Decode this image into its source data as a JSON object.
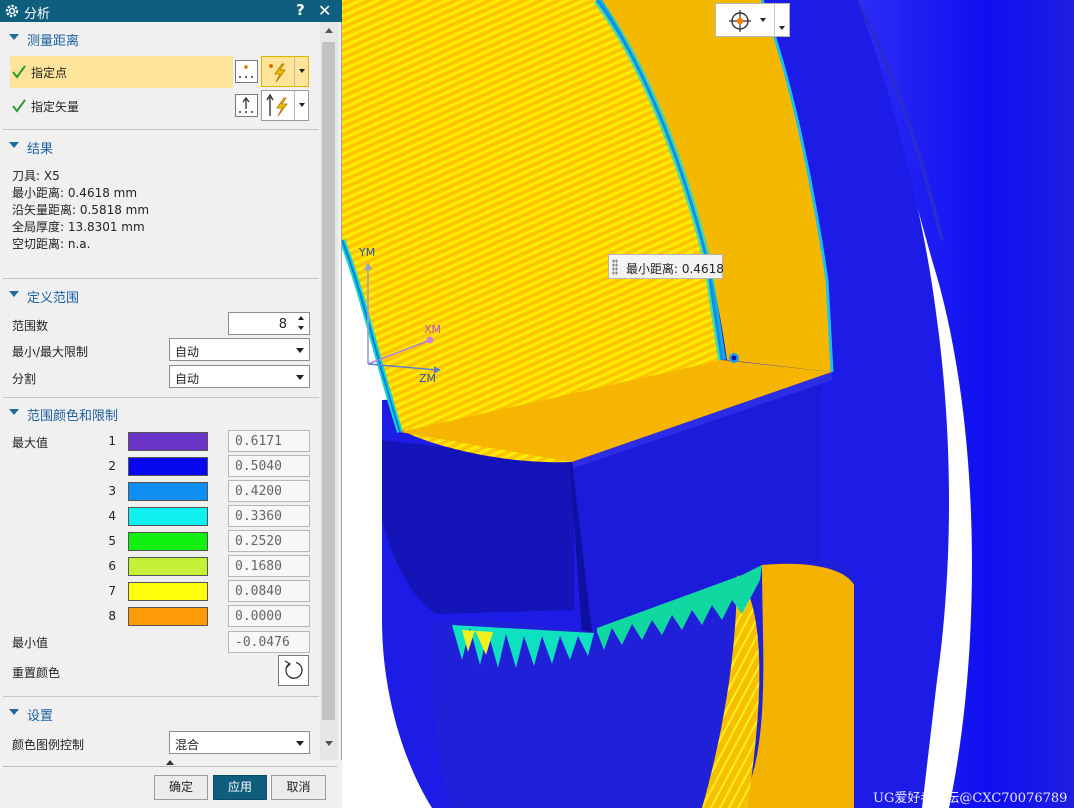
{
  "dialog": {
    "title": "分析",
    "help": "?",
    "close": "✕"
  },
  "measure": {
    "header": "测量距离",
    "point_label": "指定点",
    "vector_label": "指定矢量"
  },
  "results": {
    "header": "结果",
    "lines": [
      "刀具: X5",
      "最小距离: 0.4618 mm",
      "沿矢量距离: 0.5818 mm",
      "全局厚度: 13.8301 mm",
      "空切距离: n.a."
    ]
  },
  "range": {
    "header": "定义范围",
    "count_label": "范围数",
    "count_value": "8",
    "minmax_label": "最小/最大限制",
    "minmax_value": "自动",
    "split_label": "分割",
    "split_value": "自动"
  },
  "colors": {
    "header": "范围颜色和限制",
    "max_label": "最大值",
    "min_label": "最小值",
    "min_value": "-0.0476",
    "reset_label": "重置颜色",
    "levels": [
      {
        "n": "1",
        "color": "#6a35c8",
        "value": "0.6171"
      },
      {
        "n": "2",
        "color": "#0707f0",
        "value": "0.5040"
      },
      {
        "n": "3",
        "color": "#0d8ef0",
        "value": "0.4200"
      },
      {
        "n": "4",
        "color": "#10f0f0",
        "value": "0.3360"
      },
      {
        "n": "5",
        "color": "#10f010",
        "value": "0.2520"
      },
      {
        "n": "6",
        "color": "#c4f03a",
        "value": "0.1680"
      },
      {
        "n": "7",
        "color": "#ffff0a",
        "value": "0.0840"
      },
      {
        "n": "8",
        "color": "#ff9a08",
        "value": "0.0000"
      }
    ]
  },
  "settings": {
    "header": "设置",
    "legend_label": "颜色图例控制",
    "legend_value": "混合"
  },
  "buttons": {
    "ok": "确定",
    "apply": "应用",
    "cancel": "取消"
  },
  "viewport": {
    "tooltip": "最小距离: 0.4618",
    "axis_ym": "YM",
    "axis_xm": "XM",
    "axis_zm": "ZM",
    "watermark": "UG爱好者论坛@CXC70076789"
  }
}
